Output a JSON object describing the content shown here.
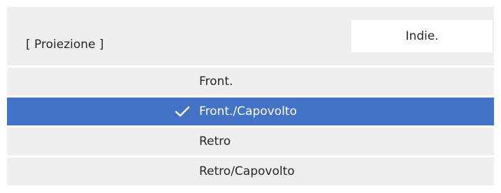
{
  "header": {
    "title": "[ Proiezione ]",
    "back_label": "Indie."
  },
  "options": [
    {
      "label": "Front.",
      "selected": false
    },
    {
      "label": "Front./Capovolto",
      "selected": true
    },
    {
      "label": "Retro",
      "selected": false
    },
    {
      "label": "Retro/Capovolto",
      "selected": false
    }
  ],
  "colors": {
    "selection": "#4472c4",
    "panel": "#efefef",
    "text": "#262626"
  },
  "icons": {
    "selected_marker": "check-icon"
  }
}
